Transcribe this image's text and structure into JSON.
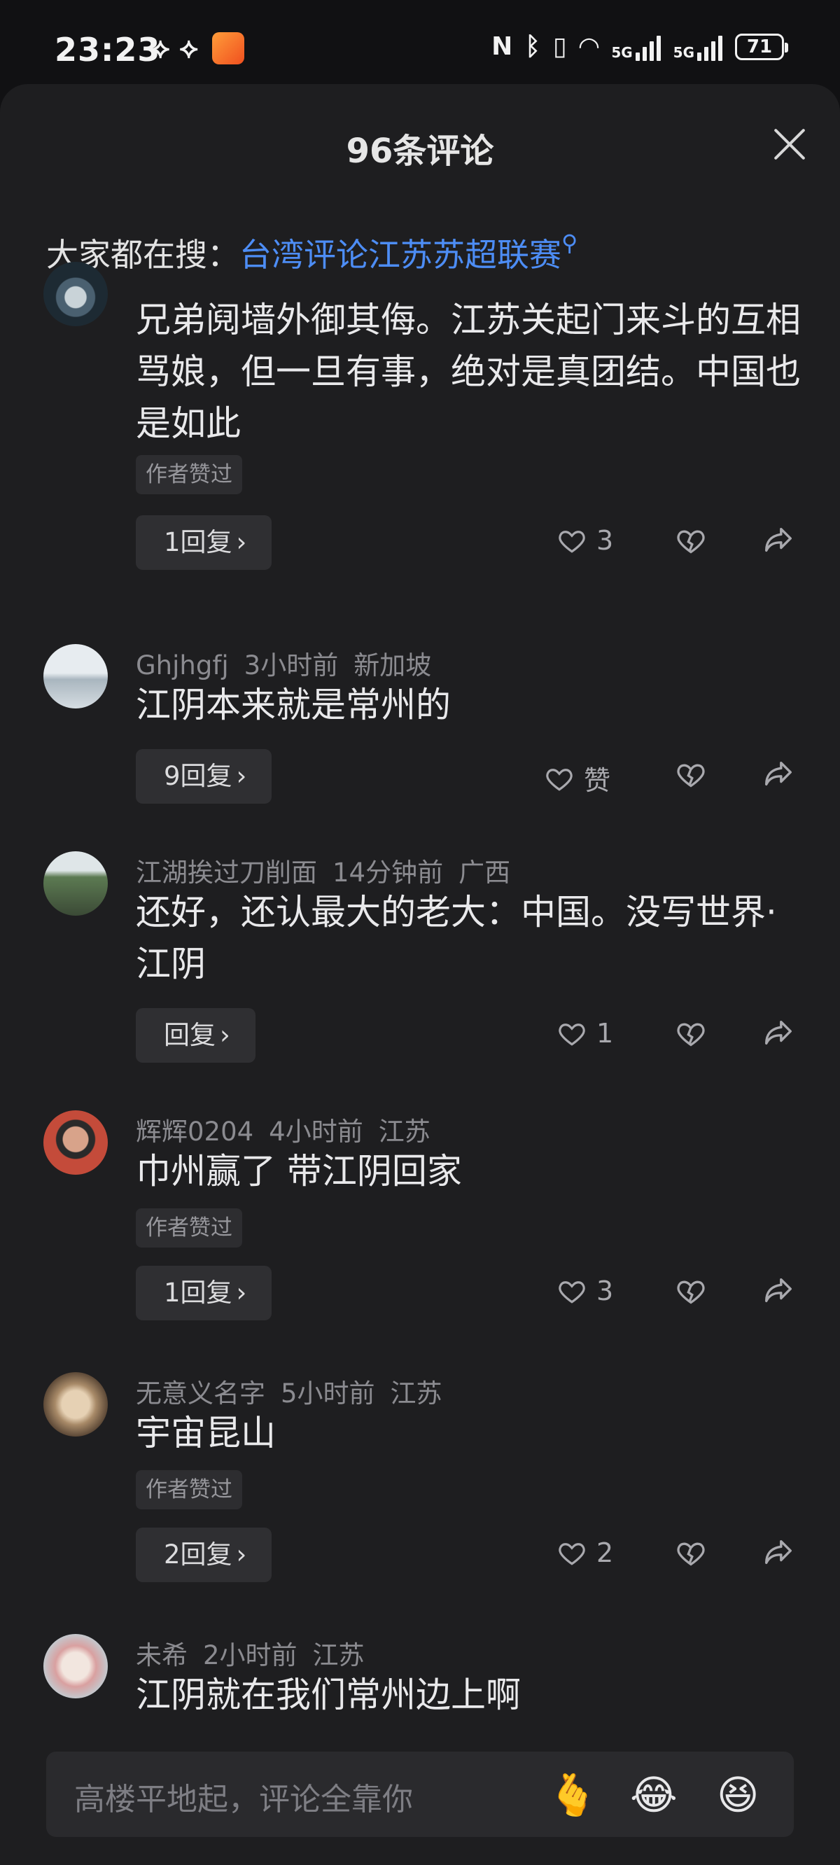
{
  "status_bar": {
    "time": "23:23",
    "left_icons": [
      "wifi-hotspot-icon",
      "wifi-hotspot-icon",
      "app-notification-icon"
    ],
    "right_icons": [
      "nfc-icon",
      "bluetooth-icon",
      "vibrate-icon",
      "wifi-icon",
      "5g-signal-icon",
      "5g-signal-icon"
    ],
    "signal_label": "5G",
    "battery": "71"
  },
  "header": {
    "title": "96条评论"
  },
  "search": {
    "prefix": "大家都在搜：",
    "query": "台湾评论江苏苏超联赛",
    "icon": "search-icon"
  },
  "comments": [
    {
      "user": "",
      "time": "",
      "location": "",
      "text": "兄弟阋墙外御其侮。江苏关起门来斗的互相骂娘，但一旦有事，绝对是真团结。中国也是如此",
      "tag": "作者赞过",
      "reply_label": "1回复",
      "likes": "3"
    },
    {
      "user": "Ghjhgfj",
      "time": "3小时前",
      "location": "新加坡",
      "text": "江阴本来就是常州的",
      "tag": "",
      "reply_label": "9回复",
      "likes": "赞"
    },
    {
      "user": "江湖挨过刀削面",
      "time": "14分钟前",
      "location": "广西",
      "text": "还好，还认最大的老大：中国。没写世界·江阴",
      "tag": "",
      "reply_label": "回复",
      "likes": "1"
    },
    {
      "user": "辉辉0204",
      "time": "4小时前",
      "location": "江苏",
      "text": "巾州赢了 带江阴回家",
      "tag": "作者赞过",
      "reply_label": "1回复",
      "likes": "3"
    },
    {
      "user": "无意义名字",
      "time": "5小时前",
      "location": "江苏",
      "text": "宇宙昆山",
      "tag": "作者赞过",
      "reply_label": "2回复",
      "likes": "2"
    },
    {
      "user": "未希",
      "time": "2小时前",
      "location": "江苏",
      "text": "江阴就在我们常州边上啊",
      "tag": "",
      "reply_label": "",
      "likes": ""
    }
  ],
  "reply_chevron": "›",
  "input": {
    "placeholder": "高楼平地起，评论全靠你",
    "emojis": [
      "🫰",
      "😂",
      "😆"
    ]
  },
  "watermark": ""
}
